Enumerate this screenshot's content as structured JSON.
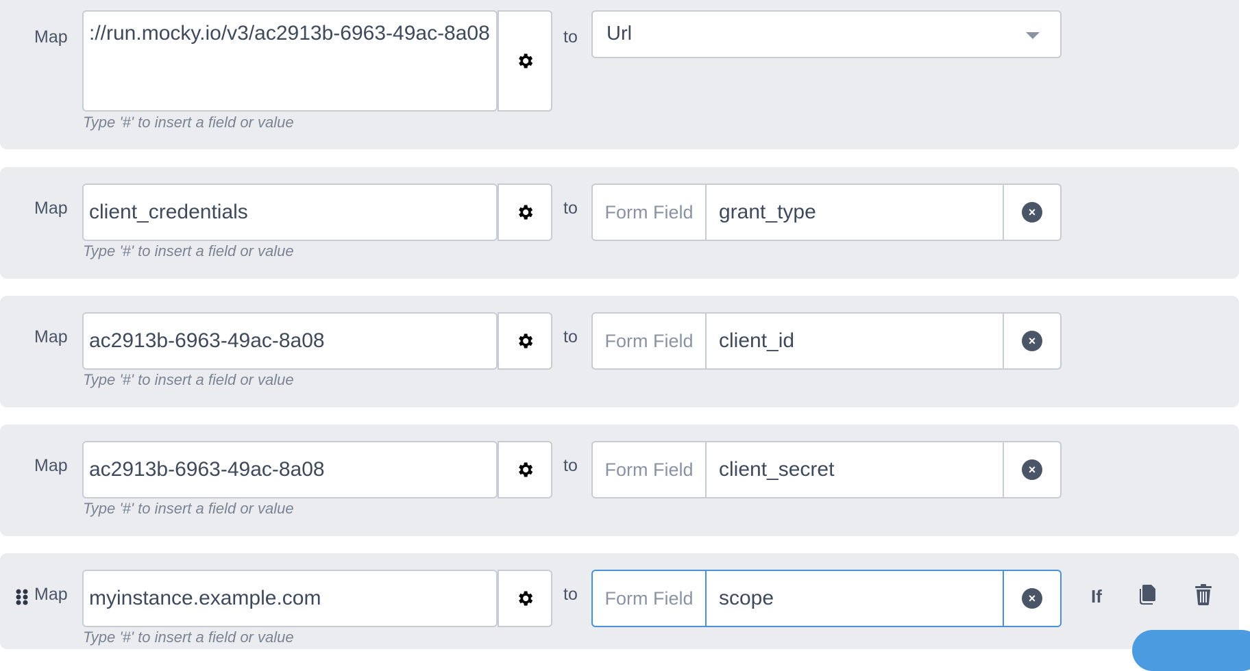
{
  "rows": [
    {
      "map_label": "Map",
      "source_value": "://run.mocky.io/v3/ac2913b-6963-49ac-8a08",
      "hint": "Type '#' to insert a field or value",
      "to_label": "to",
      "target_select_value": "Url"
    },
    {
      "map_label": "Map",
      "source_value": "client_credentials",
      "hint": "Type '#' to insert a field or value",
      "to_label": "to",
      "target_prefix": "Form Field",
      "target_value": "grant_type"
    },
    {
      "map_label": "Map",
      "source_value": "ac2913b-6963-49ac-8a08",
      "hint": "Type '#' to insert a field or value",
      "to_label": "to",
      "target_prefix": "Form Field",
      "target_value": "client_id"
    },
    {
      "map_label": "Map",
      "source_value": "ac2913b-6963-49ac-8a08",
      "hint": "Type '#' to insert a field or value",
      "to_label": "to",
      "target_prefix": "Form Field",
      "target_value": "client_secret"
    },
    {
      "map_label": "Map",
      "source_value": "myinstance.example.com",
      "hint": "Type '#' to insert a field or value",
      "to_label": "to",
      "target_prefix": "Form Field",
      "target_value": "scope"
    }
  ],
  "row_actions": {
    "if_label": "If"
  },
  "icons": {
    "settings": "gear-icon",
    "dropdown": "chevron-down-icon",
    "clear": "close-circle-icon",
    "drag": "drag-handle-icon",
    "copy": "copy-icon",
    "delete": "trash-icon"
  },
  "colors": {
    "row_background": "#eaecf0",
    "focus_border": "#4a90d9",
    "hint_text": "#7b8494"
  }
}
